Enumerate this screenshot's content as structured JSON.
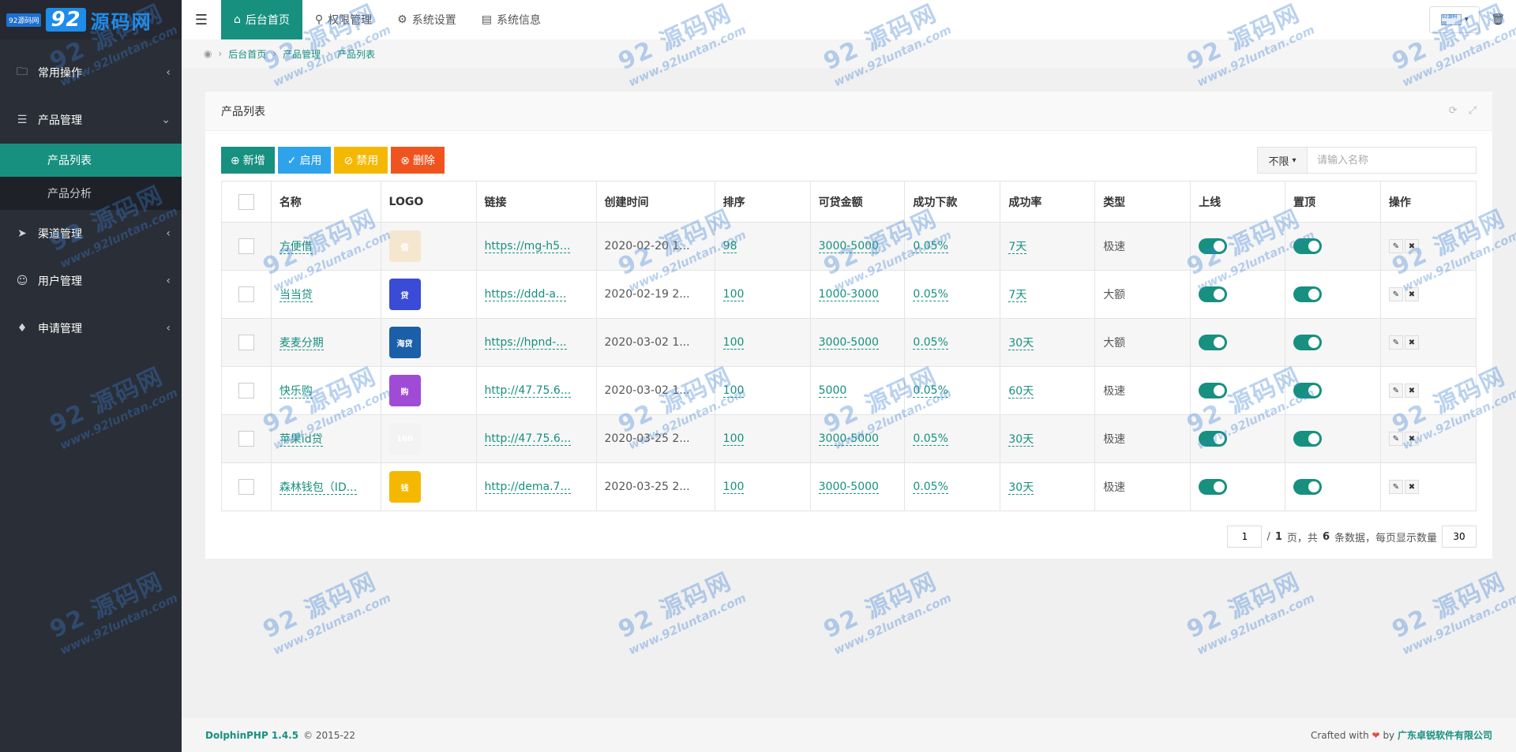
{
  "logo": {
    "small": "92源码网",
    "big_num": "92",
    "big_text": "源码网"
  },
  "sidebar": {
    "items": [
      {
        "label": "常用操作",
        "icon": "folder-icon"
      },
      {
        "label": "产品管理",
        "icon": "layers-icon"
      },
      {
        "label": "渠道管理",
        "icon": "send-icon"
      },
      {
        "label": "用户管理",
        "icon": "user-icon"
      },
      {
        "label": "申请管理",
        "icon": "tag-icon"
      }
    ],
    "sub_items": [
      {
        "label": "产品列表"
      },
      {
        "label": "产品分析"
      }
    ]
  },
  "header": {
    "tabs": [
      {
        "label": "后台首页",
        "icon": "home-icon"
      },
      {
        "label": "权限管理",
        "icon": "key-icon"
      },
      {
        "label": "系统设置",
        "icon": "gear-icon"
      },
      {
        "label": "系统信息",
        "icon": "file-icon"
      }
    ],
    "user_label": "92源码网"
  },
  "breadcrumb": [
    "后台首页",
    "产品管理",
    "产品列表"
  ],
  "panel": {
    "title": "产品列表"
  },
  "toolbar": {
    "add": "新增",
    "enable": "启用",
    "disable": "禁用",
    "delete": "删除"
  },
  "search": {
    "select_value": "不限",
    "placeholder": "请输入名称"
  },
  "table": {
    "headers": [
      "名称",
      "LOGO",
      "链接",
      "创建时间",
      "排序",
      "可贷金额",
      "成功下款",
      "成功率",
      "类型",
      "上线",
      "置顶",
      "操作"
    ],
    "rows": [
      {
        "name": "方便借",
        "logo_text": "借",
        "logo_color": "#f5e6d0",
        "link": "https://mg-h5...",
        "created": "2020-02-20 1...",
        "sort": "98",
        "amount": "3000-5000",
        "success": "0.05%",
        "rate": "7天",
        "type": "极速"
      },
      {
        "name": "当当贷",
        "logo_text": "贷",
        "logo_color": "#3a4bd6",
        "link": "https://ddd-a...",
        "created": "2020-02-19 2...",
        "sort": "100",
        "amount": "1000-3000",
        "success": "0.05%",
        "rate": "7天",
        "type": "大额"
      },
      {
        "name": "麦麦分期",
        "logo_text": "海贷",
        "logo_color": "#1b5fa8",
        "link": "https://hpnd-...",
        "created": "2020-03-02 1...",
        "sort": "100",
        "amount": "3000-5000",
        "success": "0.05%",
        "rate": "30天",
        "type": "大额"
      },
      {
        "name": "快乐购",
        "logo_text": "购",
        "logo_color": "#a04bd6",
        "link": "http://47.75.6...",
        "created": "2020-03-02 1...",
        "sort": "100",
        "amount": "5000",
        "success": "0.05%",
        "rate": "60天",
        "type": "极速"
      },
      {
        "name": "苹果id贷",
        "logo_text": "100",
        "logo_color": "#f3f3f3",
        "link": "http://47.75.6...",
        "created": "2020-03-25 2...",
        "sort": "100",
        "amount": "3000-5000",
        "success": "0.05%",
        "rate": "30天",
        "type": "极速"
      },
      {
        "name": "森林钱包（ID...",
        "logo_text": "钱",
        "logo_color": "#f5b800",
        "link": "http://dema.7...",
        "created": "2020-03-25 2...",
        "sort": "100",
        "amount": "3000-5000",
        "success": "0.05%",
        "rate": "30天",
        "type": "极速"
      }
    ]
  },
  "pager": {
    "page": "1",
    "total_pages": "1",
    "total_text_1": "页，共",
    "count": "6",
    "total_text_2": "条数据，每页显示数量",
    "per_page": "30"
  },
  "footer": {
    "brand": "DolphinPHP 1.4.5",
    "copy": "© 2015-22",
    "crafted": "Crafted with",
    "by": "by",
    "company": "广东卓锐软件有限公司"
  },
  "watermark": {
    "top": "92 源码网",
    "bottom": "www.92luntan.com"
  }
}
